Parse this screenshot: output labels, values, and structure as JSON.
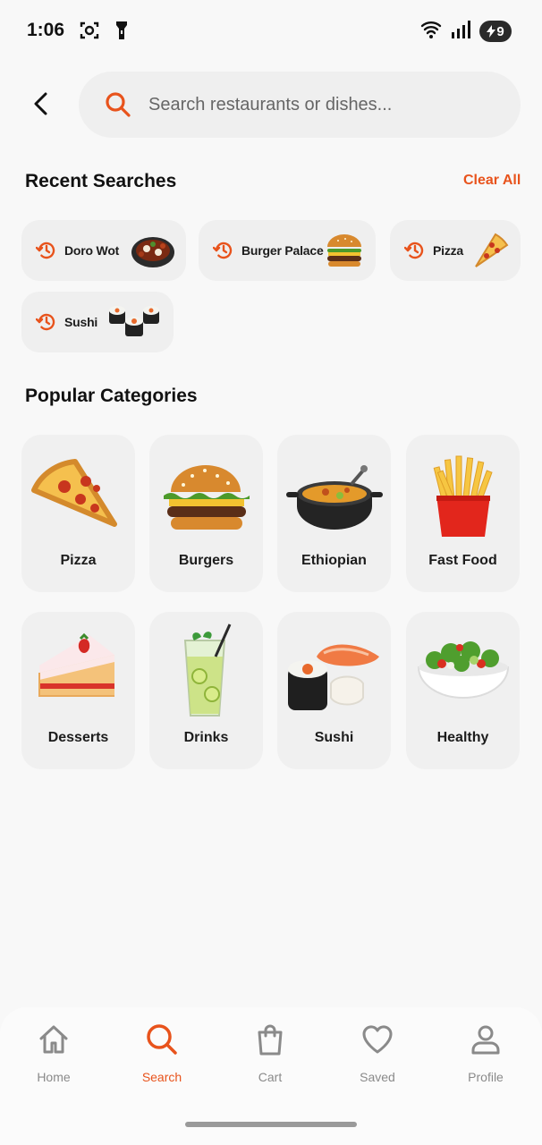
{
  "status_bar": {
    "time": "1:06",
    "battery": "9"
  },
  "search": {
    "placeholder": "Search restaurants or dishes..."
  },
  "recent": {
    "title": "Recent Searches",
    "clear_label": "Clear All",
    "items": [
      {
        "label": "Doro Wot",
        "thumb": "doro-wot-thumbnail"
      },
      {
        "label": "Burger Palace",
        "thumb": "burger-thumbnail"
      },
      {
        "label": "Pizza",
        "thumb": "pizza-slice-thumbnail"
      },
      {
        "label": "Sushi",
        "thumb": "sushi-rolls-thumbnail"
      }
    ]
  },
  "categories": {
    "title": "Popular Categories",
    "items": [
      {
        "label": "Pizza"
      },
      {
        "label": "Burgers"
      },
      {
        "label": "Ethiopian"
      },
      {
        "label": "Fast Food"
      },
      {
        "label": "Desserts"
      },
      {
        "label": "Drinks"
      },
      {
        "label": "Sushi"
      },
      {
        "label": "Healthy"
      }
    ]
  },
  "nav": {
    "items": [
      {
        "label": "Home",
        "icon": "home-icon"
      },
      {
        "label": "Search",
        "icon": "search-icon",
        "active": true
      },
      {
        "label": "Cart",
        "icon": "shopping-bag-icon"
      },
      {
        "label": "Saved",
        "icon": "heart-icon"
      },
      {
        "label": "Profile",
        "icon": "user-icon"
      }
    ]
  },
  "colors": {
    "accent": "#e8531c",
    "background": "#f8f8f8",
    "chip": "#efefef"
  }
}
